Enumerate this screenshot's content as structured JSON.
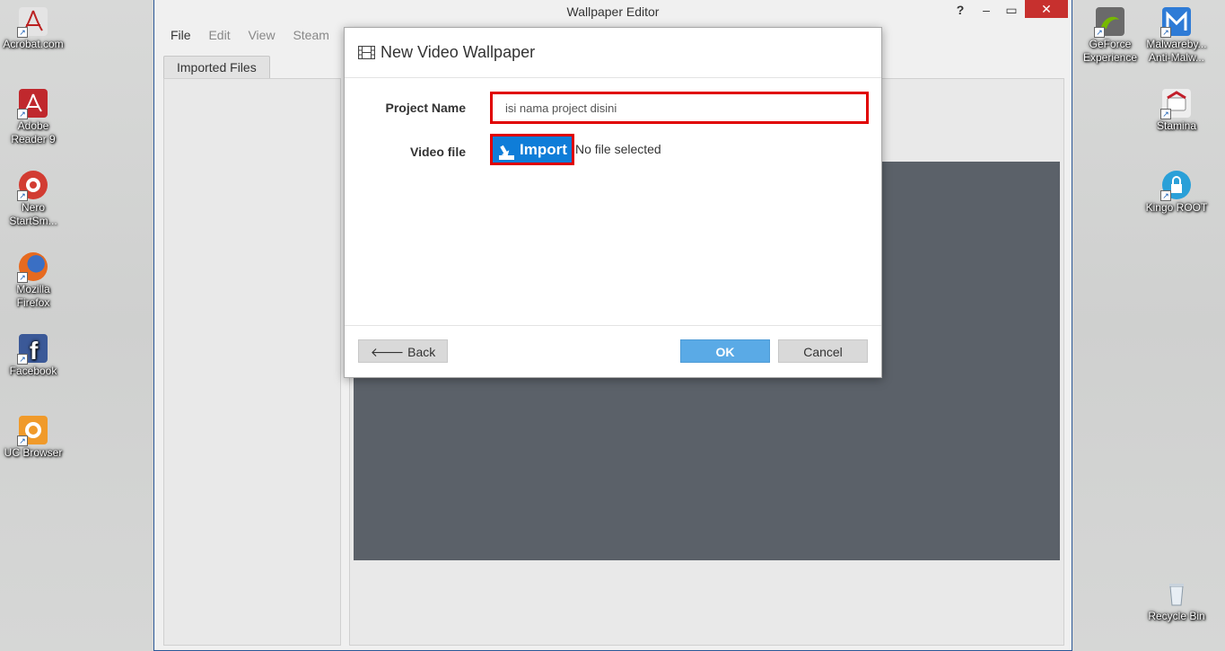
{
  "desktop": {
    "left_icons": [
      {
        "label": "Acrobat.com",
        "icon": "acrobat-icon",
        "color": "#bfbfbf"
      },
      {
        "label": "Adobe Reader 9",
        "icon": "adobe-reader-icon",
        "color": "#c0282d"
      },
      {
        "label": "Nero StartSm...",
        "icon": "nero-icon",
        "color": "#d23c32"
      },
      {
        "label": "Mozilla Firefox",
        "icon": "firefox-icon",
        "color": "#e66a1f"
      },
      {
        "label": "Facebook",
        "icon": "facebook-icon",
        "color": "#3b5998"
      },
      {
        "label": "UC Browser",
        "icon": "uc-browser-icon",
        "color": "#f09a2a"
      }
    ],
    "right_icons": [
      {
        "label": "GeForce Experience",
        "icon": "geforce-icon",
        "color": "#76b900"
      },
      {
        "label": "Malwareby... Anti-Malw...",
        "icon": "malwarebytes-icon",
        "color": "#2e7bd6"
      },
      {
        "label": "Stamina",
        "icon": "stamina-icon",
        "color": "#c21e2a"
      },
      {
        "label": "Kingo ROOT",
        "icon": "kingo-root-icon",
        "color": "#2aa0d8"
      },
      {
        "label": "Recycle Bin",
        "icon": "recycle-bin-icon",
        "color": "#e8eef4"
      }
    ]
  },
  "window": {
    "title": "Wallpaper Editor",
    "help": "?",
    "minimize": "–",
    "maximize": "▭",
    "close": "✕",
    "menu": [
      "File",
      "Edit",
      "View",
      "Steam"
    ],
    "tab": "Imported Files"
  },
  "dialog": {
    "title": "New Video Wallpaper",
    "project_name_label": "Project Name",
    "project_name_value": "isi nama project disini",
    "video_file_label": "Video file",
    "import_label": "Import",
    "no_file_text": "No file selected",
    "back_label": "Back",
    "back_arrow": "🡐",
    "ok_label": "OK",
    "cancel_label": "Cancel"
  },
  "colors": {
    "accent": "#0f7dd8",
    "ok_button": "#5aaae6",
    "highlight_border": "#e00000",
    "close_button": "#c7302e",
    "preview_bg": "#5b6169"
  }
}
